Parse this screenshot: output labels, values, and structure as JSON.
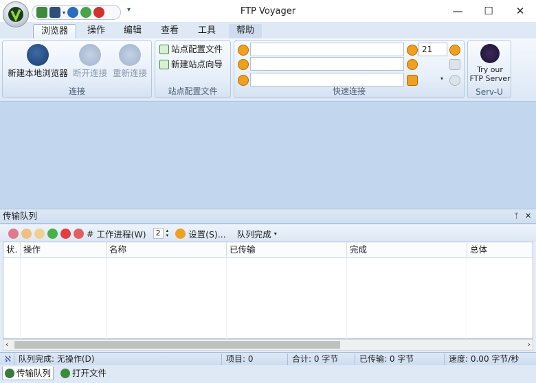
{
  "window": {
    "title": "FTP Voyager"
  },
  "qat": {
    "icons": [
      "site-icon",
      "local-icon",
      "connect-icon",
      "refresh-icon",
      "power-icon"
    ],
    "customize": "▾"
  },
  "tabs": [
    "浏览器",
    "操作",
    "编辑",
    "查看",
    "工具",
    "帮助"
  ],
  "ribbon": {
    "connect": {
      "label": "连接",
      "new_local": "新建本地浏览器",
      "disconnect": "断开连接",
      "reconnect": "重新连接"
    },
    "site_profiles": {
      "label": "站点配置文件",
      "site_profile": "站点配置文件",
      "new_site_wizard": "新建站点向导"
    },
    "quick_connect": {
      "label": "快速连接",
      "port": "21"
    },
    "servu": {
      "label": "Serv-U",
      "line1": "Try our",
      "line2": "FTP Server"
    }
  },
  "queue": {
    "title": "传输队列",
    "pin": "ᛘ",
    "close": "✕",
    "toolbar": {
      "workers_hash": "#",
      "workers_label": "工作进程(W)",
      "workers_value": "2",
      "settings": "设置(S)...",
      "queue_done": "队列完成"
    },
    "columns": [
      "状.",
      "操作",
      "名称",
      "已传输",
      "完成",
      "总体"
    ]
  },
  "status": {
    "marker": "ℵ",
    "queue_done": "队列完成: 无操作(D)",
    "items": "项目: 0",
    "total": "合计: 0 字节",
    "transferred": "已传输: 0 字节",
    "speed": "速度: 0.00 字节/秒"
  },
  "bottom_tabs": [
    "传输队列",
    "打开文件"
  ],
  "colors": {
    "accent": "#2b579a",
    "work_area": "#c2d6ee",
    "ribbon_bg": "#dce8f6"
  }
}
